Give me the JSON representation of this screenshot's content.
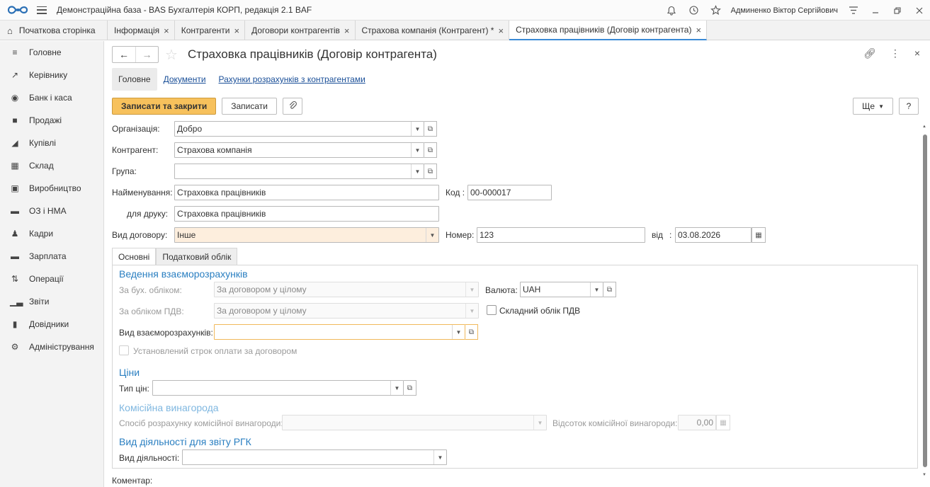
{
  "app": {
    "title": "Демонстраційна база - BAS Бухгалтерія КОРП, редакція 2.1 BAF",
    "user": "Админенко Віктор Сергійович"
  },
  "tabs": {
    "home": "Початкова сторінка",
    "items": [
      {
        "label": "Інформація"
      },
      {
        "label": "Контрагенти"
      },
      {
        "label": "Договори контрагентів"
      },
      {
        "label": "Страхова компанія (Контрагент) *"
      },
      {
        "label": "Страховка працівників (Договір контрагента)"
      }
    ]
  },
  "sidebar": {
    "items": [
      {
        "label": "Головне",
        "icon": "menu-icon"
      },
      {
        "label": "Керівнику",
        "icon": "trend-icon"
      },
      {
        "label": "Банк і каса",
        "icon": "coin-icon"
      },
      {
        "label": "Продажі",
        "icon": "bag-icon"
      },
      {
        "label": "Купівлі",
        "icon": "cart-icon"
      },
      {
        "label": "Склад",
        "icon": "warehouse-icon"
      },
      {
        "label": "Виробництво",
        "icon": "factory-icon"
      },
      {
        "label": "ОЗ і НМА",
        "icon": "truck-icon"
      },
      {
        "label": "Кадри",
        "icon": "person-icon"
      },
      {
        "label": "Зарплата",
        "icon": "wallet-icon"
      },
      {
        "label": "Операції",
        "icon": "operations-icon"
      },
      {
        "label": "Звіти",
        "icon": "chart-icon"
      },
      {
        "label": "Довідники",
        "icon": "books-icon"
      },
      {
        "label": "Адміністрування",
        "icon": "gear-icon"
      }
    ]
  },
  "form": {
    "title": "Страховка працівників (Договір контрагента)",
    "subnav": {
      "main": "Головне",
      "documents": "Документи",
      "accounts": "Рахунки розрахунків з контрагентами"
    },
    "commands": {
      "save_close": "Записати та закрити",
      "save": "Записати",
      "more": "Ще",
      "help": "?"
    },
    "organization": {
      "label": "Організація:",
      "value": "Добро"
    },
    "counterparty": {
      "label": "Контрагент:",
      "value": "Страхова компанія"
    },
    "group": {
      "label": "Група:",
      "value": ""
    },
    "name": {
      "label": "Найменування:",
      "value": "Страховка працівників"
    },
    "code": {
      "label": "Код :",
      "value": "00-000017"
    },
    "print_name": {
      "label": "для друку:",
      "value": "Страховка працівників"
    },
    "contract_type": {
      "label": "Вид договору:",
      "value": "Інше"
    },
    "number": {
      "label": "Номер:",
      "value": "123"
    },
    "date": {
      "label": "від",
      "colon": ":",
      "value": "03.08.2026"
    },
    "tabs": {
      "main": "Основні",
      "tax": "Податковий облік"
    },
    "settlements": {
      "section": "Ведення взаєморозрахунків",
      "accounting": {
        "label": "За бух. обліком:",
        "value": "За договором у цілому"
      },
      "vat": {
        "label": "За обліком ПДВ:",
        "value": "За договором у цілому"
      },
      "currency": {
        "label": "Валюта:",
        "value": "UAH"
      },
      "complex_vat": {
        "label": "Складний облік ПДВ",
        "checked": false
      },
      "settlement_type": {
        "label": "Вид взаєморозрахунків:",
        "value": ""
      },
      "payment_term": {
        "label": "Установлений строк оплати за договором",
        "checked": false
      }
    },
    "prices": {
      "section": "Ціни",
      "price_type": {
        "label": "Тип цін:",
        "value": ""
      }
    },
    "commission": {
      "section": "Комісійна винагорода",
      "method": {
        "label": "Спосіб розрахунку комісійної винагороди:",
        "value": ""
      },
      "percent": {
        "label": "Відсоток комісійної винагороди:",
        "value": "0,00"
      }
    },
    "activity": {
      "section": "Вид діяльності для звіту РГК",
      "type": {
        "label": "Вид діяльності:",
        "value": ""
      }
    },
    "comment": {
      "label": "Коментар:"
    }
  },
  "colors": {
    "accent": "#2a7fc1",
    "primary_button": "#f7c15c",
    "highlight_field": "#fdeedd",
    "active_tab_line": "#3a8ad6"
  }
}
